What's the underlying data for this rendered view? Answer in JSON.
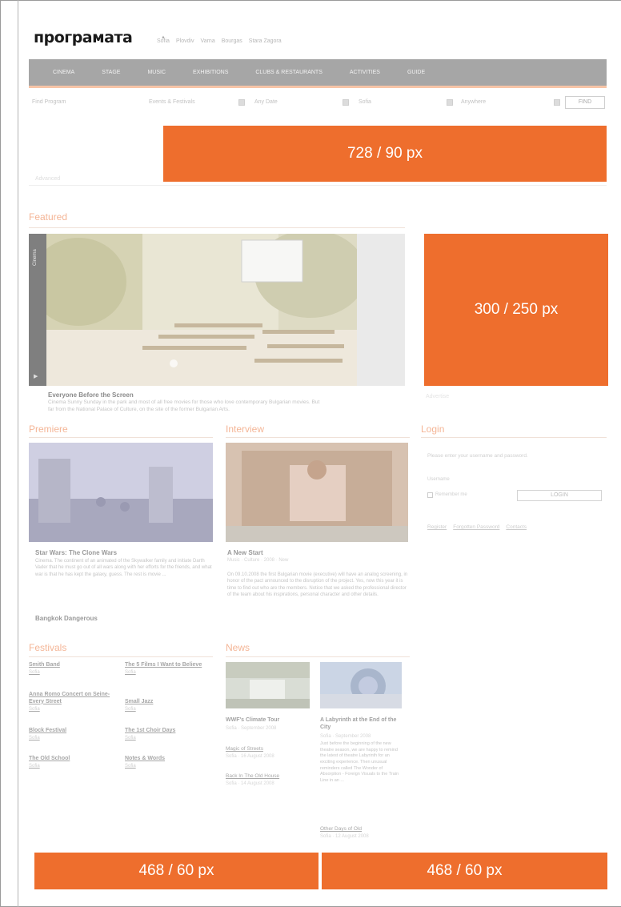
{
  "header": {
    "logo": "програмата",
    "top_links": [
      "Sofia",
      "Plovdiv",
      "Varna",
      "Bourgas",
      "Stara Zagora"
    ]
  },
  "nav": [
    "CINEMA",
    "STAGE",
    "MUSIC",
    "EXHIBITIONS",
    "CLUBS & RESTAURANTS",
    "ACTIVITIES",
    "GUIDE"
  ],
  "filters": {
    "label": "Find Program",
    "select1": "Events & Festivals",
    "select2": "Any Date",
    "select3": "Sofia",
    "select4": "Anywhere",
    "find_button": "FIND"
  },
  "filter_footnote": "Advanced",
  "ads": {
    "leaderboard": "728 / 90 px",
    "rectangle": "300 / 250 px",
    "banner_left": "468 / 60 px",
    "banner_right": "468 / 60 px"
  },
  "featured": {
    "section_title": "Featured",
    "side_label": "Cinema",
    "caption_title": "Everyone Before the Screen",
    "caption_text": "Cinema Sunny Sunday in the park and most of all free movies for those who love contemporary Bulgarian movies. But far from the National Palace of Culture, on the site of the former Bulgarian Arts."
  },
  "rect_caption": "Advertise",
  "premiere": {
    "section_title": "Premiere",
    "title": "Star Wars: The Clone Wars",
    "text": "Cinema. The continent of an animated of the Skywalker family and initiate Darth Vader that he must go out of all wars along with her efforts for the friends, and what war is that he has kept the galaxy, guess. The rest is movie ...",
    "extra": "Bangkok Dangerous"
  },
  "interview": {
    "section_title": "Interview",
    "title": "A New Start",
    "meta": "Music · Culture · 2008 · New",
    "text": "On 09.10.2008 the first Bulgarian movie (executive) will have an analog screening, in honor of the pact announced to the disruption of the project. Yes, now this year it is time to find out who are the members. Notice that we asked the professional director of the team about his inspirations, personal character and other details."
  },
  "login": {
    "section_title": "Login",
    "hint": "Please enter your username and password.",
    "username_label": "Username",
    "remember_label": "Remember me",
    "button": "LOGIN",
    "links": [
      "Register",
      "Forgotten Password",
      "Contacts"
    ]
  },
  "festivals": {
    "section_title": "Festivals",
    "items": [
      {
        "title": "Smith Band",
        "sub": "Sofia"
      },
      {
        "title": "The 5 Films I Want to Believe",
        "sub": "Sofia"
      },
      {
        "title": "Anna Romo Concert on Seine-Every Street",
        "sub": "Sofia"
      },
      {
        "title": "Small Jazz",
        "sub": "Sofia"
      },
      {
        "title": "Block Festival",
        "sub": "Sofia"
      },
      {
        "title": "The 1st Choir Days",
        "sub": "Sofia"
      },
      {
        "title": "The Old School",
        "sub": "Sofia"
      },
      {
        "title": "Notes & Words",
        "sub": "Sofia"
      }
    ]
  },
  "news": {
    "section_title": "News",
    "left": {
      "title": "WWF's Climate Tour",
      "meta": "Sofia · September 2008",
      "links": [
        {
          "title": "Magic of Streets",
          "meta": "Sofia · 16 August 2008"
        },
        {
          "title": "Back In The Old House",
          "meta": "Sofia · 14 August 2008"
        }
      ]
    },
    "right": {
      "title": "A Labyrinth at the End of the City",
      "meta": "Sofia · September 2008",
      "text": "Just before the beginning of the new theatre season, we are happy to remind the latest of theatre Labyrinth for an exciting experience. Then unusual reminders called The Wonder of Absorption - Foreign Visuals to the Train Line in an ...",
      "link_title": "Other Days of Old",
      "link_meta": "Sofia · 12 August 2008"
    }
  },
  "colors": {
    "accent": "#ee6e2d",
    "nav_bg": "#a6a6a6"
  }
}
